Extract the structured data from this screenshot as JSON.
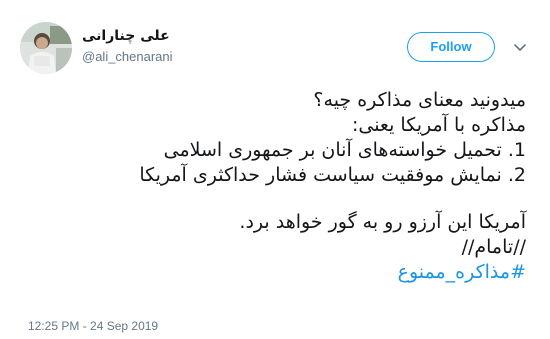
{
  "user": {
    "display_name": "علی چنارانی",
    "handle": "@ali_chenarani"
  },
  "actions": {
    "follow_label": "Follow"
  },
  "icons": {
    "avatar": "profile-photo",
    "caret": "chevron-down-icon"
  },
  "tweet": {
    "lines": [
      "میدونید معنای مذاکره چیه؟",
      "مذاکره با آمریکا یعنی:",
      "1. تحمیل خواسته‌های آنان بر جمهوری اسلامی",
      "2. نمایش موفقیت سیاست فشار حداکثری آمریکا",
      "",
      "آمریکا این آرزو رو به گور خواهد برد.",
      "//تامام//"
    ],
    "hashtag": "#مذاکره_ممنوع"
  },
  "timestamp": "12:25 PM - 24 Sep 2019",
  "colors": {
    "accent": "#1da1f2",
    "hashtag": "#1b95e0",
    "secondary_text": "#657786",
    "primary_text": "#14171a"
  }
}
